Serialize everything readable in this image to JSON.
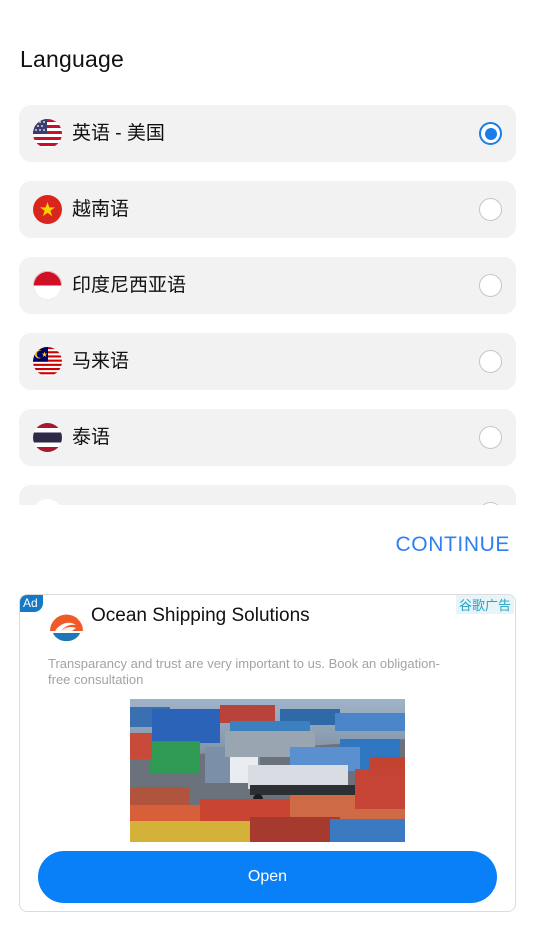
{
  "page": {
    "title": "Language"
  },
  "languages": [
    {
      "label": "英语 - 美国",
      "flag": "us-flag-icon",
      "selected": true
    },
    {
      "label": "越南语",
      "flag": "vietnam-flag-icon",
      "selected": false
    },
    {
      "label": "印度尼西亚语",
      "flag": "indonesia-flag-icon",
      "selected": false
    },
    {
      "label": "马来语",
      "flag": "malaysia-flag-icon",
      "selected": false
    },
    {
      "label": "泰语",
      "flag": "thailand-flag-icon",
      "selected": false
    }
  ],
  "continue_label": "CONTINUE",
  "ad": {
    "badge": "Ad",
    "choices_label": "谷歌广告",
    "headline": "Ocean Shipping Solutions",
    "body": "Transparancy and trust are very important to us. Book an obligation-free consultation",
    "cta": "Open"
  },
  "colors": {
    "accent": "#1a7ee8",
    "continue": "#2f7ff0",
    "cta": "#0a80f8",
    "item_bg": "#f2f2f2"
  }
}
